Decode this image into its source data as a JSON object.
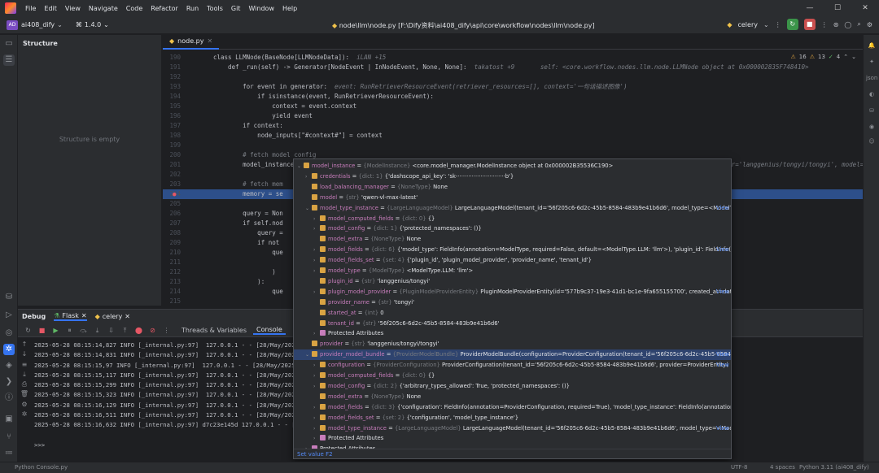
{
  "menu": {
    "items": [
      "File",
      "Edit",
      "View",
      "Navigate",
      "Code",
      "Refactor",
      "Run",
      "Tools",
      "Git",
      "Window",
      "Help"
    ]
  },
  "toolbar": {
    "project_badge": "AD",
    "project": "ai408_dify",
    "version": "1.4.0",
    "path": "node\\llm\\node.py [F:\\Dify资料\\ai408_dify\\api\\core\\workflow\\nodes\\llm\\node.py]",
    "run_config": "celery"
  },
  "structure": {
    "title": "Structure",
    "empty": "Structure is empty"
  },
  "editor": {
    "tab": "node.py",
    "warnings": "16",
    "warnings2": "13",
    "ok": "4",
    "lines": [
      {
        "n": "190",
        "t": "class LLMNode(BaseNode[LLMNodeData]):",
        "h": "  iLAN +15"
      },
      {
        "n": "191",
        "t": "    def _run(self) -> Generator[NodeEvent | InNodeEvent, None, None]:",
        "h": "  takatost +9       self: <core.workflow.nodes.llm.node.LLMNode object at 0x000002835F748410>"
      },
      {
        "n": "192",
        "t": "",
        "h": ""
      },
      {
        "n": "193",
        "t": "        for event in generator:",
        "h": "  event: RunRetrieverResourceEvent(retriever_resources=[], context='一句话描述图像')"
      },
      {
        "n": "194",
        "t": "            if isinstance(event, RunRetrieverResourceEvent):",
        "h": ""
      },
      {
        "n": "195",
        "t": "                context = event.context",
        "h": ""
      },
      {
        "n": "196",
        "t": "                yield event",
        "h": ""
      },
      {
        "n": "197",
        "t": "        if context:",
        "h": ""
      },
      {
        "n": "198",
        "t": "            node_inputs[\"#context#\"] = context",
        "h": ""
      },
      {
        "n": "199",
        "t": "",
        "h": ""
      },
      {
        "n": "200",
        "t": "        # fetch model config",
        "h": ""
      },
      {
        "n": "201",
        "t": "        model_instance, model_config = self._fetch_model_config(self.node_data.model)",
        "h": "  model_config: ModelConfigWithCredentialsEntity(provider='langgenius/tongyi/tongyi', model='qwen-v"
      },
      {
        "n": "202",
        "t": "",
        "h": ""
      },
      {
        "n": "203",
        "t": "        # fetch mem",
        "h": ""
      },
      {
        "n": "204",
        "t": "        memory = se",
        "h": ""
      },
      {
        "n": "205",
        "t": "",
        "h": ""
      },
      {
        "n": "206",
        "t": "        query = Non",
        "h": ""
      },
      {
        "n": "207",
        "t": "        if self.nod",
        "h": ""
      },
      {
        "n": "208",
        "t": "            query =",
        "h": ""
      },
      {
        "n": "209",
        "t": "            if not",
        "h": ""
      },
      {
        "n": "210",
        "t": "                que",
        "h": ""
      },
      {
        "n": "211",
        "t": "",
        "h": ""
      },
      {
        "n": "212",
        "t": "                )",
        "h": ""
      },
      {
        "n": "213",
        "t": "            ):",
        "h": ""
      },
      {
        "n": "214",
        "t": "                que",
        "h": ""
      },
      {
        "n": "215",
        "t": "",
        "h": ""
      },
      {
        "n": "216",
        "t": "        prompt_mess",
        "h": ""
      }
    ]
  },
  "debug": {
    "title": "Debug",
    "tab1": "Flask",
    "tab2": "celery",
    "threads": "Threads & Variables",
    "console": "Console",
    "log": [
      "2025-05-28 08:15:14,827 INFO [_internal.py:97]  127.0.0.1 - - [28/May/2025",
      "2025-05-28 08:15:14,831 INFO [_internal.py:97]  127.0.0.1 - - [28/May/2025",
      "2025-05-28 08:15:15,97 INFO [_internal.py:97]  127.0.0.1 - - [28/May/2025 1",
      "2025-05-28 08:15:15,117 INFO [_internal.py:97]  127.0.0.1 - - [28/May/2025",
      "2025-05-28 08:15:15,299 INFO [_internal.py:97]  127.0.0.1 - - [28/May/2025",
      "2025-05-28 08:15:15,323 INFO [_internal.py:97]  127.0.0.1 - - [28/May/2025",
      "2025-05-28 08:15:16,129 INFO [_internal.py:97]  127.0.0.1 - - [28/May/2025",
      "2025-05-28 08:15:16,511 INFO [_internal.py:97]  127.0.0.1 - - [28/May/2025",
      "2025-05-28 08:15:16,632 INFO [_internal.py:97] d7c23e145d 127.0.0.1 - - [28",
      "",
      ">>>"
    ]
  },
  "popup": {
    "rows": [
      {
        "d": 0,
        "a": "v",
        "i": "f",
        "k": "model_instance",
        "ty": "{ModelInstance}",
        "v": "<core.model_manager.ModelInstance object at 0x000002B35536C190>",
        "view": ""
      },
      {
        "d": 1,
        "a": ">",
        "i": "f",
        "k": "credentials",
        "ty": "{dict: 1}",
        "v": "{'dashscope_api_key': 'sk-···························b'}",
        "view": ""
      },
      {
        "d": 1,
        "a": "",
        "i": "f",
        "k": "load_balancing_manager",
        "ty": "{NoneType}",
        "v": "None",
        "view": ""
      },
      {
        "d": 1,
        "a": "",
        "i": "f",
        "k": "model",
        "ty": "{str}",
        "v": "'qwen-vl-max-latest'",
        "view": ""
      },
      {
        "d": 1,
        "a": "v",
        "i": "f",
        "k": "model_type_instance",
        "ty": "{LargeLanguageModel}",
        "v": "LargeLanguageModel(tenant_id='56f205c6-6d2c-45b5-8584-483b9e41b6d6', model_type=<ModelType.LLM:",
        "view": "View"
      },
      {
        "d": 2,
        "a": ">",
        "i": "f",
        "k": "model_computed_fields",
        "ty": "{dict: 0}",
        "v": "{}",
        "view": ""
      },
      {
        "d": 2,
        "a": ">",
        "i": "f",
        "k": "model_config",
        "ty": "{dict: 1}",
        "v": "{'protected_namespaces': ()}",
        "view": ""
      },
      {
        "d": 2,
        "a": "",
        "i": "f",
        "k": "model_extra",
        "ty": "{NoneType}",
        "v": "None",
        "view": ""
      },
      {
        "d": 2,
        "a": ">",
        "i": "f",
        "k": "model_fields",
        "ty": "{dict: 6}",
        "v": "{'model_type': FieldInfo(annotation=ModelType, required=False, default=<ModelType.LLM: 'llm'>), 'plugin_id': FieldInfo(annotati",
        "view": "View"
      },
      {
        "d": 2,
        "a": ">",
        "i": "f",
        "k": "model_fields_set",
        "ty": "{set: 4}",
        "v": "{'plugin_id', 'plugin_model_provider', 'provider_name', 'tenant_id'}",
        "view": ""
      },
      {
        "d": 2,
        "a": ">",
        "i": "f",
        "k": "model_type",
        "ty": "{ModelType}",
        "v": "<ModelType.LLM: 'llm'>",
        "view": ""
      },
      {
        "d": 2,
        "a": "",
        "i": "f",
        "k": "plugin_id",
        "ty": "{str}",
        "v": "'langgenius/tongyi'",
        "view": ""
      },
      {
        "d": 2,
        "a": ">",
        "i": "f",
        "k": "plugin_model_provider",
        "ty": "{PluginModelProviderEntity}",
        "v": "PluginModelProviderEntity(id='577b9c37-19e3-41d1-bc1e-9fa655155700', created_at=datetime.",
        "view": "View"
      },
      {
        "d": 2,
        "a": "",
        "i": "f",
        "k": "provider_name",
        "ty": "{str}",
        "v": "'tongyi'",
        "view": ""
      },
      {
        "d": 2,
        "a": "",
        "i": "f",
        "k": "started_at",
        "ty": "{int}",
        "v": "0",
        "view": ""
      },
      {
        "d": 2,
        "a": "",
        "i": "f",
        "k": "tenant_id",
        "ty": "{str}",
        "v": "'56f205c6-6d2c-45b5-8584-483b9e41b6d6'",
        "view": ""
      },
      {
        "d": 2,
        "a": ">",
        "i": "p",
        "k": "Protected Attributes",
        "ty": "",
        "v": "",
        "view": ""
      },
      {
        "d": 1,
        "a": "",
        "i": "f",
        "k": "provider",
        "ty": "{str}",
        "v": "'langgenius/tongyi/tongyi'",
        "view": ""
      },
      {
        "d": 1,
        "a": "v",
        "i": "f",
        "k": "provider_model_bundle",
        "ty": "{ProviderModelBundle}",
        "v": "ProviderModelBundle(configuration=ProviderConfiguration(tenant_id='56f205c6-6d2c-45b5-8584-483b...",
        "view": "View",
        "sel": true
      },
      {
        "d": 2,
        "a": ">",
        "i": "f",
        "k": "configuration",
        "ty": "{ProviderConfiguration}",
        "v": "ProviderConfiguration(tenant_id='56f205c6-6d2c-45b5-8584-483b9e41b6d6', provider=ProviderEntity(",
        "view": "View"
      },
      {
        "d": 2,
        "a": ">",
        "i": "f",
        "k": "model_computed_fields",
        "ty": "{dict: 0}",
        "v": "{}",
        "view": ""
      },
      {
        "d": 2,
        "a": ">",
        "i": "f",
        "k": "model_config",
        "ty": "{dict: 2}",
        "v": "{'arbitrary_types_allowed': True, 'protected_namespaces': ()}",
        "view": ""
      },
      {
        "d": 2,
        "a": "",
        "i": "f",
        "k": "model_extra",
        "ty": "{NoneType}",
        "v": "None",
        "view": ""
      },
      {
        "d": 2,
        "a": ">",
        "i": "f",
        "k": "model_fields",
        "ty": "{dict: 3}",
        "v": "{'configuration': FieldInfo(annotation=ProviderConfiguration, required=True), 'model_type_instance': FieldInfo(annotation=AIModel, req",
        "view": ""
      },
      {
        "d": 2,
        "a": ">",
        "i": "f",
        "k": "model_fields_set",
        "ty": "{set: 2}",
        "v": "{'configuration', 'model_type_instance'}",
        "view": ""
      },
      {
        "d": 2,
        "a": ">",
        "i": "f",
        "k": "model_type_instance",
        "ty": "{LargeLanguageModel}",
        "v": "LargeLanguageModel(tenant_id='56f205c6-6d2c-45b5-8584-483b9e41b6d6', model_type=<ModelType...",
        "view": "View"
      },
      {
        "d": 2,
        "a": ">",
        "i": "p",
        "k": "Protected Attributes",
        "ty": "",
        "v": "",
        "view": ""
      },
      {
        "d": 1,
        "a": ">",
        "i": "p",
        "k": "Protected Attributes",
        "ty": "",
        "v": "",
        "view": ""
      }
    ],
    "footer": "Set value  F2"
  },
  "status": {
    "left": "Python Console.py",
    "lf": "LF",
    "enc": "UTF-8",
    "indent": "4 spaces",
    "interp": "Python 3.11 (ai408_dify)"
  }
}
